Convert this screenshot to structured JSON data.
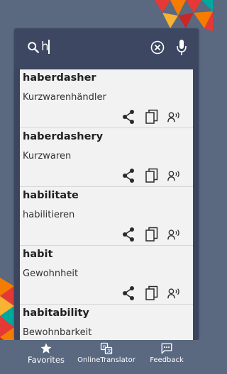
{
  "search": {
    "query": "h"
  },
  "entries": [
    {
      "word": "haberdasher",
      "translation": "Kurzwarenhändler"
    },
    {
      "word": "haberdashery",
      "translation": "Kurzwaren"
    },
    {
      "word": "habilitate",
      "translation": "habilitieren"
    },
    {
      "word": "habit",
      "translation": "Gewohnheit"
    },
    {
      "word": "habitability",
      "translation": "Bewohnbarkeit"
    }
  ],
  "bottom_nav": {
    "favorites": "Favorites",
    "online_translator": "OnlineTranslator",
    "feedback": "Feedback"
  },
  "colors": {
    "background": "#5a6880",
    "search_bar": "#3d4762",
    "list_background": "#f2f2f2",
    "icon_dark": "#2b2b2b",
    "deco_red": "#e53935",
    "deco_orange": "#f57c00",
    "deco_yellow": "#f9b233",
    "deco_teal": "#00a99d"
  }
}
